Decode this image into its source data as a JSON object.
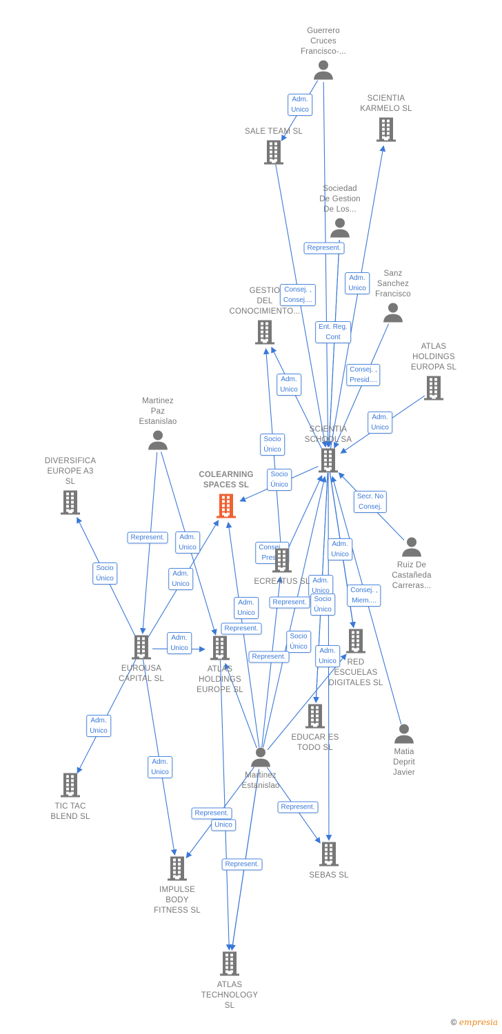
{
  "colors": {
    "edge": "#3a78d8",
    "node": "#777777",
    "main_node": "#f06030"
  },
  "nodes": [
    {
      "id": "guerrero",
      "type": "person",
      "label": "Guerrero\nCruces\nFrancisco-..."
    },
    {
      "id": "scientia_karmelo",
      "type": "company",
      "label": "SCIENTIA\nKARMELO  SL"
    },
    {
      "id": "sale_team",
      "type": "company",
      "label": "SALE TEAM  SL"
    },
    {
      "id": "sociedad",
      "type": "person",
      "label": "Sociedad\nDe Gestion\nDe Los..."
    },
    {
      "id": "sanz",
      "type": "person",
      "label": "Sanz\nSanchez\nFrancisco"
    },
    {
      "id": "gestio",
      "type": "company",
      "label": "GESTIO\nDEL\nCONOCIMIENTO..."
    },
    {
      "id": "atlas_holdings_europa",
      "type": "company",
      "label": "ATLAS\nHOLDINGS\nEUROPA  SL"
    },
    {
      "id": "martinez_paz",
      "type": "person",
      "label": "Martinez\nPaz\nEstanislao"
    },
    {
      "id": "scientia_school",
      "type": "company",
      "label": "SCIENTIA\nSCHOOL SA"
    },
    {
      "id": "diversifica",
      "type": "company",
      "label": "DIVERSIFICA\nEUROPE A3\nSL"
    },
    {
      "id": "colearning",
      "type": "company",
      "main": true,
      "label": "COLEARNING\nSPACES  SL"
    },
    {
      "id": "ruiz",
      "type": "person",
      "label": "Ruiz De\nCastañeda\nCarreras..."
    },
    {
      "id": "ecreatus",
      "type": "company",
      "label": "ECREATUS  SL"
    },
    {
      "id": "eurousa",
      "type": "company",
      "label": "EUROUSA\nCAPITAL  SL"
    },
    {
      "id": "atlas_holdings_europe",
      "type": "company",
      "label": "ATLAS\nHOLDINGS\nEUROPE  SL"
    },
    {
      "id": "red_escuelas",
      "type": "company",
      "label": "RED\nESCUELAS\nDIGITALES  SL"
    },
    {
      "id": "educar",
      "type": "company",
      "label": "EDUCAR ES\nTODO  SL"
    },
    {
      "id": "matia",
      "type": "person",
      "label": "Matia\nDeprit\nJavier"
    },
    {
      "id": "martinez_est",
      "type": "person",
      "label": "Martinez\nEstanislao"
    },
    {
      "id": "tic_tac",
      "type": "company",
      "label": "TIC TAC\nBLEND  SL"
    },
    {
      "id": "sebas",
      "type": "company",
      "label": "SEBAS  SL"
    },
    {
      "id": "impulse",
      "type": "company",
      "label": "IMPULSE\nBODY\nFITNESS  SL"
    },
    {
      "id": "atlas_tech",
      "type": "company",
      "label": "ATLAS\nTECHNOLOGY\nSL"
    }
  ],
  "edges": [
    {
      "from": "guerrero",
      "to": "sale_team",
      "label": "Adm.\nUnico"
    },
    {
      "from": "guerrero",
      "to": "scientia_school",
      "label": ""
    },
    {
      "from": "sociedad",
      "to": "scientia_school",
      "label": "Represent."
    },
    {
      "from": "sale_team",
      "to": "scientia_school",
      "label": "Consej. ,\nConsej...."
    },
    {
      "from": "scientia_school",
      "to": "scientia_karmelo",
      "label": "Adm.\nUnico"
    },
    {
      "from": "sociedad",
      "to": "scientia_school",
      "label": "Ent.  Reg.\nCont"
    },
    {
      "from": "sanz",
      "to": "scientia_school",
      "label": "Consej. ,\nPresid...."
    },
    {
      "from": "scientia_school",
      "to": "gestio",
      "label": "Adm.\nUnico"
    },
    {
      "from": "atlas_holdings_europa",
      "to": "scientia_school",
      "label": "Adm.\nUnico"
    },
    {
      "from": "ecreatus",
      "to": "gestio",
      "label": "Socio\nÚnico"
    },
    {
      "from": "scientia_school",
      "to": "colearning",
      "label": "Socio\nÚnico"
    },
    {
      "from": "ruiz",
      "to": "scientia_school",
      "label": "Secr.  No\nConsej."
    },
    {
      "from": "martinez_paz",
      "to": "eurousa",
      "label": "Represent."
    },
    {
      "from": "martinez_paz",
      "to": "atlas_holdings_europe",
      "label": "Adm.\nUnico"
    },
    {
      "from": "eurousa",
      "to": "diversifica",
      "label": "Socio\nÚnico"
    },
    {
      "from": "eurousa",
      "to": "colearning",
      "label": "Adm.\nUnico"
    },
    {
      "from": "ecreatus",
      "to": "scientia_school",
      "label": "Consej. ,\nPresid."
    },
    {
      "from": "scientia_school",
      "to": "red_escuelas",
      "label": "Adm.\nUnico"
    },
    {
      "from": "matia",
      "to": "scientia_school",
      "label": "Consej. ,\nMiem...."
    },
    {
      "from": "scientia_school",
      "to": "red_escuelas",
      "label": "Adm.\nUnico"
    },
    {
      "from": "martinez_est",
      "to": "ecreatus",
      "label": "Adm.\nUnico"
    },
    {
      "from": "martinez_est",
      "to": "red_escuelas",
      "label": "Represent."
    },
    {
      "from": "scientia_school",
      "to": "red_escuelas",
      "label": "Socio\nÚnico"
    },
    {
      "from": "martinez_est",
      "to": "atlas_holdings_europe",
      "label": "Represent."
    },
    {
      "from": "eurousa",
      "to": "atlas_holdings_europe",
      "label": "Adm.\nUnico"
    },
    {
      "from": "scientia_school",
      "to": "educar",
      "label": "Socio\nÚnico"
    },
    {
      "from": "scientia_school",
      "to": "educar",
      "label": "Adm.\nUnico"
    },
    {
      "from": "martinez_est",
      "to": "scientia_school",
      "label": "Represent."
    },
    {
      "from": "martinez_est",
      "to": "colearning",
      "label": ""
    },
    {
      "from": "eurousa",
      "to": "tic_tac",
      "label": "Adm.\nUnico"
    },
    {
      "from": "eurousa",
      "to": "impulse",
      "label": "Adm.\nUnico"
    },
    {
      "from": "martinez_est",
      "to": "impulse",
      "label": "Represent."
    },
    {
      "from": "martinez_est",
      "to": "atlas_tech",
      "label": "Unico"
    },
    {
      "from": "martinez_est",
      "to": "sebas",
      "label": "Represent."
    },
    {
      "from": "martinez_est",
      "to": "atlas_tech",
      "label": "Represent."
    },
    {
      "from": "atlas_holdings_europe",
      "to": "atlas_tech",
      "label": ""
    },
    {
      "from": "scientia_school",
      "to": "sebas",
      "label": ""
    }
  ],
  "footer": {
    "copyright_symbol": "©",
    "brand": "empresia"
  }
}
